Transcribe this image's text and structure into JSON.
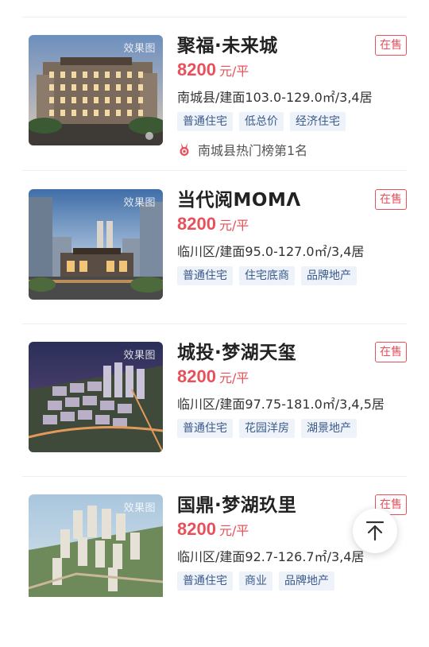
{
  "listings": [
    {
      "thumb_label": "效果图",
      "title": "聚福·未来城",
      "status": "在售",
      "price": "8200",
      "price_unit": "元/平",
      "desc": "南城县/建面103.0-129.0㎡/3,4居",
      "tags": [
        "普通住宅",
        "低总价",
        "经济住宅"
      ],
      "rank": "南城县热门榜第1名"
    },
    {
      "thumb_label": "效果图",
      "title": "当代阅MOMΛ",
      "status": "在售",
      "price": "8200",
      "price_unit": "元/平",
      "desc": "临川区/建面95.0-127.0㎡/3,4居",
      "tags": [
        "普通住宅",
        "住宅底商",
        "品牌地产"
      ]
    },
    {
      "thumb_label": "效果图",
      "title": "城投·梦湖天玺",
      "status": "在售",
      "price": "8200",
      "price_unit": "元/平",
      "desc": "临川区/建面97.75-181.0㎡/3,4,5居",
      "tags": [
        "普通住宅",
        "花园洋房",
        "湖景地产"
      ]
    },
    {
      "thumb_label": "效果图",
      "title": "国鼎·梦湖玖里",
      "status": "在售",
      "price": "8200",
      "price_unit": "元/平",
      "desc": "临川区/建面92.7-126.7㎡/3,4居",
      "tags": [
        "普通住宅",
        "商业",
        "品牌地产"
      ]
    }
  ],
  "icons": {
    "rank": "medal-icon",
    "scroll_top": "arrow-up-to-top-icon"
  },
  "colors": {
    "accent_red": "#e8505b",
    "tag_bg": "#eef3f9",
    "tag_text": "#3c5a8a"
  }
}
